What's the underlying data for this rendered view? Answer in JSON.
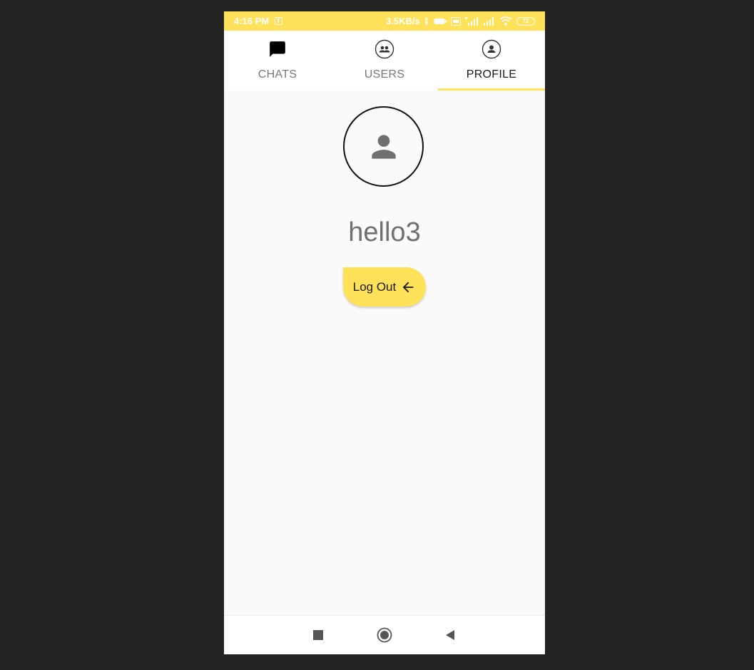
{
  "status_bar": {
    "time": "4:16 PM",
    "speed": "3.5KB/s",
    "battery_level": "72",
    "background_color": "#ffe15a"
  },
  "tabs": [
    {
      "label": "CHATS",
      "icon": "chat-bubble-icon",
      "active": false
    },
    {
      "label": "USERS",
      "icon": "group-icon",
      "active": false
    },
    {
      "label": "PROFILE",
      "icon": "account-circle-icon",
      "active": true
    }
  ],
  "profile": {
    "avatar_icon": "person-icon",
    "username": "hello3",
    "logout_label": "Log Out",
    "logout_icon": "arrow-left-icon"
  },
  "nav_bar": {
    "buttons": [
      "recents-square-icon",
      "home-circle-icon",
      "back-triangle-icon"
    ]
  },
  "colors": {
    "accent": "#ffe15a",
    "text_muted": "#777777",
    "text_active": "#1a1a1a",
    "background": "#fafafa"
  }
}
